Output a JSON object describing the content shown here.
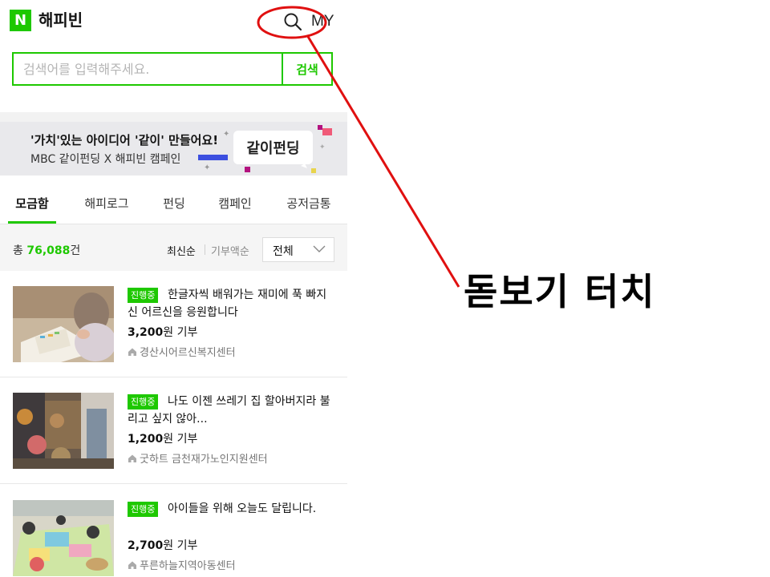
{
  "header": {
    "logo_mark": "N",
    "app_name": "해피빈",
    "search_icon": "search-icon",
    "my_label": "MY"
  },
  "search": {
    "placeholder": "검색어를 입력해주세요.",
    "button_label": "검색"
  },
  "banner": {
    "line1": "'가치'있는 아이디어 '같이' 만들어요!",
    "line2": "MBC 같이펀딩 X 해피빈 캠페인",
    "logo_text": "같이펀딩"
  },
  "tabs": [
    {
      "label": "모금함",
      "active": true
    },
    {
      "label": "해피로그",
      "active": false
    },
    {
      "label": "펀딩",
      "active": false
    },
    {
      "label": "캠페인",
      "active": false
    },
    {
      "label": "공저금통",
      "active": false
    }
  ],
  "filter": {
    "total_prefix": "총 ",
    "total_count": "76,088",
    "total_suffix": "건",
    "sort_recent": "최신순",
    "sort_amount": "기부액순",
    "select_value": "전체"
  },
  "items": [
    {
      "badge": "진행중",
      "title": "한글자씩 배워가는 재미에 푹 빠지신 어르신을 응원합니다",
      "amount": "3,200",
      "amount_suffix": "원 기부",
      "org": "경산시어르신복지센터"
    },
    {
      "badge": "진행중",
      "title": "나도 이젠 쓰레기 집 할아버지라 불리고 싶지 않아...",
      "amount": "1,200",
      "amount_suffix": "원 기부",
      "org": "굿하트 금천재가노인지원센터"
    },
    {
      "badge": "진행중",
      "title": "아이들을 위해 오늘도 달립니다.",
      "amount": "2,700",
      "amount_suffix": "원 기부",
      "org": "푸른하늘지역아동센터"
    }
  ],
  "annotation": {
    "label": "돋보기 터치"
  },
  "colors": {
    "brand_green": "#1ec800",
    "annotation_red": "#e01010"
  }
}
